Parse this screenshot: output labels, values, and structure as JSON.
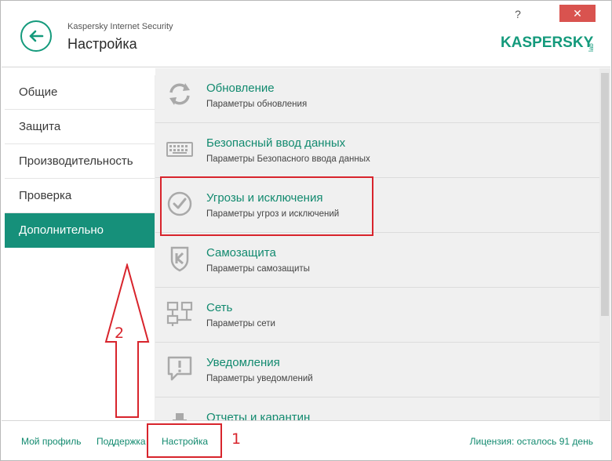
{
  "header": {
    "app_name": "Kaspersky Internet Security",
    "title": "Настройка",
    "help": "?",
    "close": "✕",
    "logo_text": "KASPERSKY",
    "logo_sub": "lab"
  },
  "sidebar": {
    "items": [
      {
        "label": "Общие"
      },
      {
        "label": "Защита"
      },
      {
        "label": "Производительность"
      },
      {
        "label": "Проверка"
      },
      {
        "label": "Дополнительно"
      }
    ]
  },
  "content": {
    "items": [
      {
        "title": "Обновление",
        "desc": "Параметры обновления",
        "icon": "refresh-icon"
      },
      {
        "title": "Безопасный ввод данных",
        "desc": "Параметры Безопасного ввода данных",
        "icon": "keyboard-icon"
      },
      {
        "title": "Угрозы и исключения",
        "desc": "Параметры угроз и исключений",
        "icon": "check-circle-icon"
      },
      {
        "title": "Самозащита",
        "desc": "Параметры самозащиты",
        "icon": "shield-k-icon"
      },
      {
        "title": "Сеть",
        "desc": "Параметры сети",
        "icon": "network-icon"
      },
      {
        "title": "Уведомления",
        "desc": "Параметры уведомлений",
        "icon": "alert-icon"
      },
      {
        "title": "Отчеты и карантин",
        "desc": "",
        "icon": "reports-icon"
      }
    ]
  },
  "footer": {
    "profile": "Мой профиль",
    "support": "Поддержка",
    "settings": "Настройка",
    "license": "Лицензия: осталось 91 день"
  },
  "annotations": {
    "n1": "1",
    "n2": "2"
  },
  "colors": {
    "accent": "#149a7c",
    "active_bg": "#16907a",
    "annotation": "#d8242c"
  }
}
